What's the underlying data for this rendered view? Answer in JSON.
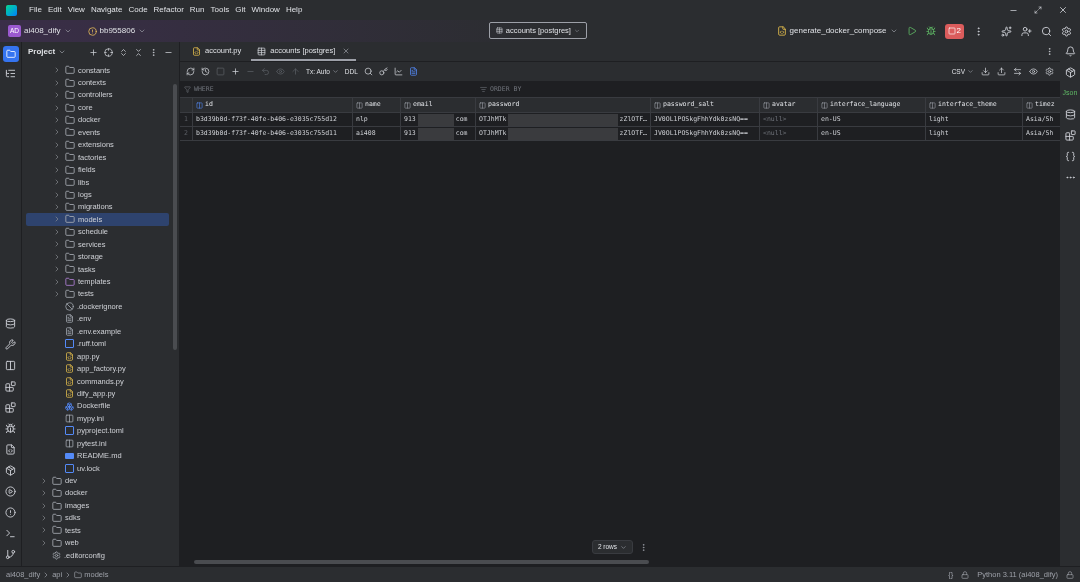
{
  "menu": [
    "File",
    "Edit",
    "View",
    "Navigate",
    "Code",
    "Refactor",
    "Run",
    "Tools",
    "Git",
    "Window",
    "Help"
  ],
  "toolbar": {
    "project_badge": "AD",
    "project": "ai408_dify",
    "branch": "bb955806",
    "center_tab": "accounts [postgres]",
    "run_config": "generate_docker_compose",
    "stop_badge": "2"
  },
  "project_panel": {
    "title": "Project"
  },
  "tree": {
    "folder_children": [
      {
        "label": "constants",
        "kind": "package",
        "expanded": false,
        "selected": false
      },
      {
        "label": "contexts",
        "kind": "package",
        "expanded": false,
        "selected": false
      },
      {
        "label": "controllers",
        "kind": "package",
        "expanded": false,
        "selected": false
      },
      {
        "label": "core",
        "kind": "package",
        "expanded": false,
        "selected": false
      },
      {
        "label": "docker",
        "kind": "folder",
        "expanded": false,
        "selected": false
      },
      {
        "label": "events",
        "kind": "package",
        "expanded": false,
        "selected": false
      },
      {
        "label": "extensions",
        "kind": "package",
        "expanded": false,
        "selected": false
      },
      {
        "label": "factories",
        "kind": "package",
        "expanded": false,
        "selected": false
      },
      {
        "label": "fields",
        "kind": "package",
        "expanded": false,
        "selected": false
      },
      {
        "label": "libs",
        "kind": "package",
        "expanded": false,
        "selected": false
      },
      {
        "label": "logs",
        "kind": "folder",
        "expanded": false,
        "selected": false
      },
      {
        "label": "migrations",
        "kind": "folder",
        "expanded": false,
        "selected": false
      },
      {
        "label": "models",
        "kind": "package",
        "expanded": false,
        "selected": true
      },
      {
        "label": "schedule",
        "kind": "folder",
        "expanded": false,
        "selected": false
      },
      {
        "label": "services",
        "kind": "package",
        "expanded": false,
        "selected": false
      },
      {
        "label": "storage",
        "kind": "folder",
        "expanded": false,
        "selected": false
      },
      {
        "label": "tasks",
        "kind": "package",
        "expanded": false,
        "selected": false
      },
      {
        "label": "templates",
        "kind": "templates",
        "expanded": false,
        "selected": false
      },
      {
        "label": "tests",
        "kind": "package",
        "expanded": false,
        "selected": false
      },
      {
        "label": ".dockerignore",
        "kind": "ignore",
        "selected": false
      },
      {
        "label": ".env",
        "kind": "text",
        "selected": false
      },
      {
        "label": ".env.example",
        "kind": "text",
        "selected": false
      },
      {
        "label": ".ruff.toml",
        "kind": "toml",
        "selected": false
      },
      {
        "label": "app.py",
        "kind": "python",
        "selected": false
      },
      {
        "label": "app_factory.py",
        "kind": "python",
        "selected": false
      },
      {
        "label": "commands.py",
        "kind": "python",
        "selected": false
      },
      {
        "label": "dify_app.py",
        "kind": "python",
        "selected": false
      },
      {
        "label": "Dockerfile",
        "kind": "docker",
        "selected": false
      },
      {
        "label": "mypy.ini",
        "kind": "ini",
        "selected": false
      },
      {
        "label": "pyproject.toml",
        "kind": "toml",
        "selected": false
      },
      {
        "label": "pytest.ini",
        "kind": "ini",
        "selected": false
      },
      {
        "label": "README.md",
        "kind": "markdown",
        "selected": false
      },
      {
        "label": "uv.lock",
        "kind": "toml",
        "selected": false
      }
    ],
    "siblings": [
      {
        "label": "dev",
        "kind": "folder",
        "expanded": false,
        "selected": false
      },
      {
        "label": "docker",
        "kind": "folder",
        "expanded": false,
        "selected": false
      },
      {
        "label": "images",
        "kind": "folder",
        "expanded": false,
        "selected": false
      },
      {
        "label": "sdks",
        "kind": "folder",
        "expanded": false,
        "selected": false
      },
      {
        "label": "tests",
        "kind": "folder",
        "expanded": false,
        "selected": false
      },
      {
        "label": "web",
        "kind": "folder",
        "expanded": false,
        "selected": false
      },
      {
        "label": ".editorconfig",
        "kind": "config",
        "selected": false
      }
    ]
  },
  "editor_tabs": [
    {
      "label": "account.py",
      "kind": "python",
      "selected": false
    },
    {
      "label": "accounts [postgres]",
      "kind": "table",
      "selected": true
    }
  ],
  "data_toolbar": {
    "tx": "Tx: Auto",
    "ddl": "DDL",
    "format": "CSV"
  },
  "filter": {
    "where": "WHERE",
    "order_by": "ORDER BY"
  },
  "table": {
    "columns": [
      "id",
      "name",
      "email",
      "password",
      "password_salt",
      "avatar",
      "interface_language",
      "interface_theme",
      "timez"
    ],
    "rows": [
      {
        "number": "1",
        "cells": [
          "b3d39b0d-f73f-40fe-b406-e3035c755d12",
          "nlp",
          [
            "913",
            "com"
          ],
          [
            "OTJhMTk",
            "zZlOTF…"
          ],
          "JV0OL1POSkgFhhYdk0zsNQ==",
          "<null>",
          "en-US",
          "light",
          "Asia/Sh"
        ]
      },
      {
        "number": "2",
        "cells": [
          "b3d39b0d-f73f-40fe-b406-e3035c755d11",
          "ai408",
          [
            "913",
            "com"
          ],
          [
            "OTJhMTk",
            "zZlOTF…"
          ],
          "JV0OL1POSkgFhhYdk0zsNQ==",
          "<null>",
          "en-US",
          "light",
          "Asia/Sh"
        ]
      }
    ]
  },
  "row_count": "2 rows",
  "right_strip": {
    "json": "Json"
  },
  "status_bar": {
    "path": [
      "ai408_dify",
      "api",
      "models"
    ],
    "braces": "{}",
    "interpreter": "Python 3.11 (ai408_dify)"
  }
}
